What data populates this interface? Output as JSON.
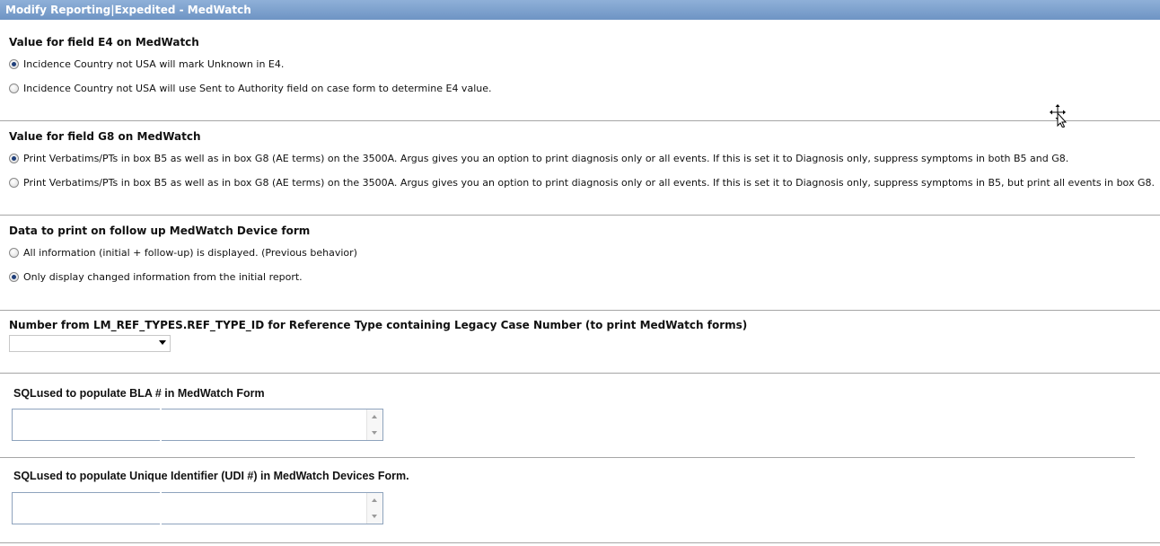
{
  "window": {
    "title": "Modify Reporting|Expedited - MedWatch"
  },
  "sections": {
    "e4": {
      "heading": "Value for field E4 on MedWatch",
      "options": [
        {
          "label": "Incidence Country not USA will mark Unknown in E4.",
          "checked": true
        },
        {
          "label": "Incidence Country not USA will use Sent to Authority field on case form to determine E4 value.",
          "checked": false
        }
      ]
    },
    "g8": {
      "heading": "Value for field G8 on MedWatch",
      "options": [
        {
          "label": "Print Verbatims/PTs in box B5 as well as in box G8 (AE terms) on the 3500A. Argus gives you an option to print diagnosis only or all events. If this is set it to Diagnosis only, suppress symptoms in both B5 and G8.",
          "checked": true
        },
        {
          "label": "Print Verbatims/PTs in box B5 as well as in box G8 (AE terms) on the 3500A. Argus gives you an option to print diagnosis only or all events. If this is set it to Diagnosis only, suppress symptoms in B5, but print all events in box G8.",
          "checked": false
        }
      ]
    },
    "device_followup": {
      "heading": "Data to print on follow up MedWatch Device form",
      "options": [
        {
          "label": "All information (initial + follow-up) is displayed. (Previous behavior)",
          "checked": false
        },
        {
          "label": "Only display changed information from the initial report.",
          "checked": true
        }
      ]
    },
    "legacy_ref": {
      "heading": "Number from LM_REF_TYPES.REF_TYPE_ID for Reference Type containing Legacy Case Number (to print MedWatch forms)",
      "selected_value": ""
    },
    "bla_sql": {
      "heading": "SQLused to populate BLA # in MedWatch Form",
      "value": ""
    },
    "udi_sql": {
      "heading": "SQLused to populate Unique Identifier (UDI #) in MedWatch Devices Form.",
      "value": ""
    }
  },
  "colors": {
    "title_bar": "#7a9ccb",
    "divider": "#a6a6a6",
    "radio_dot": "#1f3f7a"
  },
  "icons": {
    "cursor": "move-cursor-icon"
  }
}
